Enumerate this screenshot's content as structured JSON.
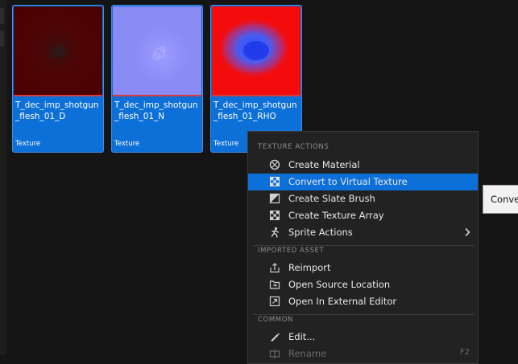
{
  "assets": [
    {
      "name_line1": "T_dec_imp_shotgun",
      "name_line2": "_flesh_01_D",
      "type": "Texture",
      "thumb_color": "#4a0000"
    },
    {
      "name_line1": "T_dec_imp_shotgun",
      "name_line2": "_flesh_01_N",
      "type": "Texture",
      "thumb_color": "#8a8af2"
    },
    {
      "name_line1": "T_dec_imp_shotgun",
      "name_line2": "_flesh_01_RHO",
      "type": "Texture",
      "thumb_color": "#f40c0c"
    }
  ],
  "context_menu": {
    "texture_actions_header": "TEXTURE ACTIONS",
    "texture_actions": [
      {
        "label": "Create Material",
        "icon": "material-sphere-icon"
      },
      {
        "label": "Convert to Virtual Texture",
        "icon": "virtual-texture-icon",
        "highlighted": true
      },
      {
        "label": "Create Slate Brush",
        "icon": "slate-brush-icon"
      },
      {
        "label": "Create Texture Array",
        "icon": "texture-array-icon"
      },
      {
        "label": "Sprite Actions",
        "icon": "sprite-icon",
        "has_submenu": true
      }
    ],
    "imported_asset_header": "IMPORTED ASSET",
    "imported_asset": [
      {
        "label": "Reimport",
        "icon": "reimport-icon"
      },
      {
        "label": "Open Source Location",
        "icon": "folder-icon"
      },
      {
        "label": "Open In External Editor",
        "icon": "external-editor-icon"
      }
    ],
    "common_header": "COMMON",
    "common": [
      {
        "label": "Edit...",
        "icon": "pencil-icon"
      },
      {
        "label": "Rename",
        "icon": "rename-icon",
        "shortcut": "F2",
        "disabled": true
      }
    ]
  },
  "tooltip": {
    "text": "Conve"
  },
  "colors": {
    "accent": "#0d6fd8",
    "menu_bg": "#222222",
    "background": "#151515"
  }
}
